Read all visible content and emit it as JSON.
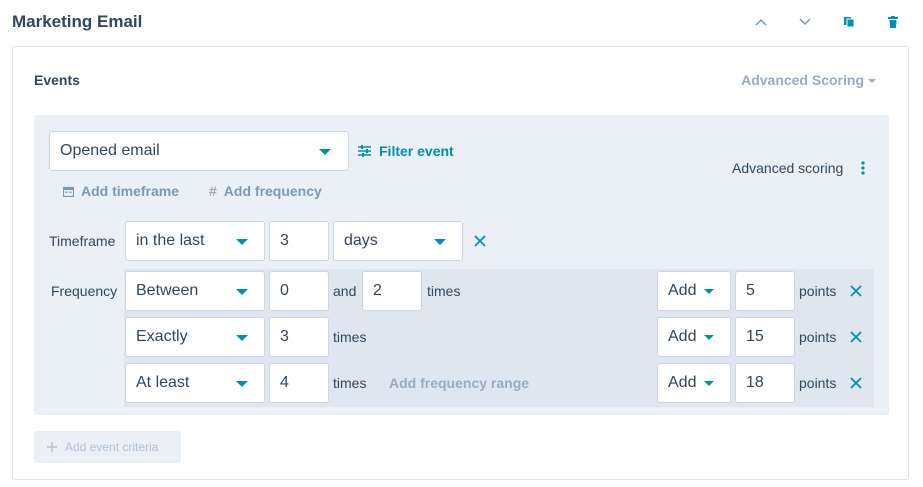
{
  "header": {
    "title": "Marketing Email"
  },
  "events": {
    "label": "Events",
    "advanced_scoring_dropdown": "Advanced Scoring",
    "event_select": "Opened email",
    "filter_event": "Filter event",
    "advanced_scoring_label": "Advanced scoring",
    "add_timeframe": "Add timeframe",
    "add_frequency": "Add frequency",
    "timeframe": {
      "label": "Timeframe",
      "operator": "in the last",
      "value": "3",
      "unit": "days"
    },
    "frequency": {
      "label": "Frequency",
      "rows": [
        {
          "operator": "Between",
          "value1": "0",
          "connector": "and",
          "value2": "2",
          "suffix": "times",
          "action": "Add",
          "points": "5",
          "points_label": "points"
        },
        {
          "operator": "Exactly",
          "value1": "3",
          "suffix": "times",
          "action": "Add",
          "points": "15",
          "points_label": "points"
        },
        {
          "operator": "At least",
          "value1": "4",
          "suffix": "times",
          "action": "Add",
          "points": "18",
          "points_label": "points"
        }
      ],
      "add_range": "Add frequency range"
    },
    "add_event_criteria": "Add event criteria"
  },
  "colors": {
    "accent": "#0091ae",
    "text": "#33475b",
    "muted": "#99acc2",
    "panel_bg": "#eaf0f6",
    "border": "#cbd6e2"
  },
  "icons": [
    "chevron-up-icon",
    "chevron-down-icon",
    "clone-icon",
    "trash-icon",
    "filter-icon",
    "calendar-icon",
    "hash-icon",
    "kebab-icon",
    "close-icon",
    "plus-icon"
  ]
}
